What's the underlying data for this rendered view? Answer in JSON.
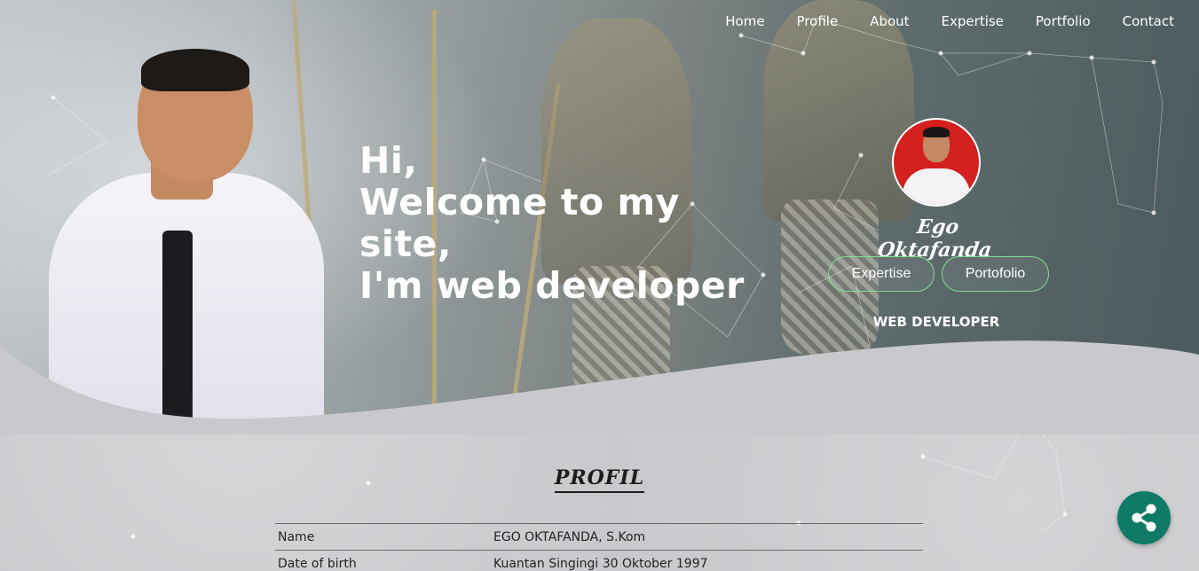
{
  "nav": {
    "items": [
      "Home",
      "Profile",
      "About",
      "Expertise",
      "Portfolio",
      "Contact"
    ]
  },
  "hero": {
    "lines": [
      "Hi,",
      "Welcome to my",
      "site,",
      "I'm web developer"
    ]
  },
  "card": {
    "signature": "Ego Oktafanda",
    "buttons": {
      "expertise": "Expertise",
      "portfolio": "Portofolio"
    },
    "role": "WEB DEVELOPER"
  },
  "profile": {
    "title": "PROFIL",
    "rows": [
      {
        "key": "Name",
        "value": "EGO OKTAFANDA, S.Kom"
      },
      {
        "key": "Date of birth",
        "value": "Kuantan Singingi 30 Oktober 1997"
      }
    ]
  },
  "share": {
    "icon": "share-icon"
  },
  "colors": {
    "accent_green": "#7ee08f",
    "share_bg": "#0f7b66",
    "text_light": "#ffffff",
    "text_dark": "#1c1c1c"
  }
}
